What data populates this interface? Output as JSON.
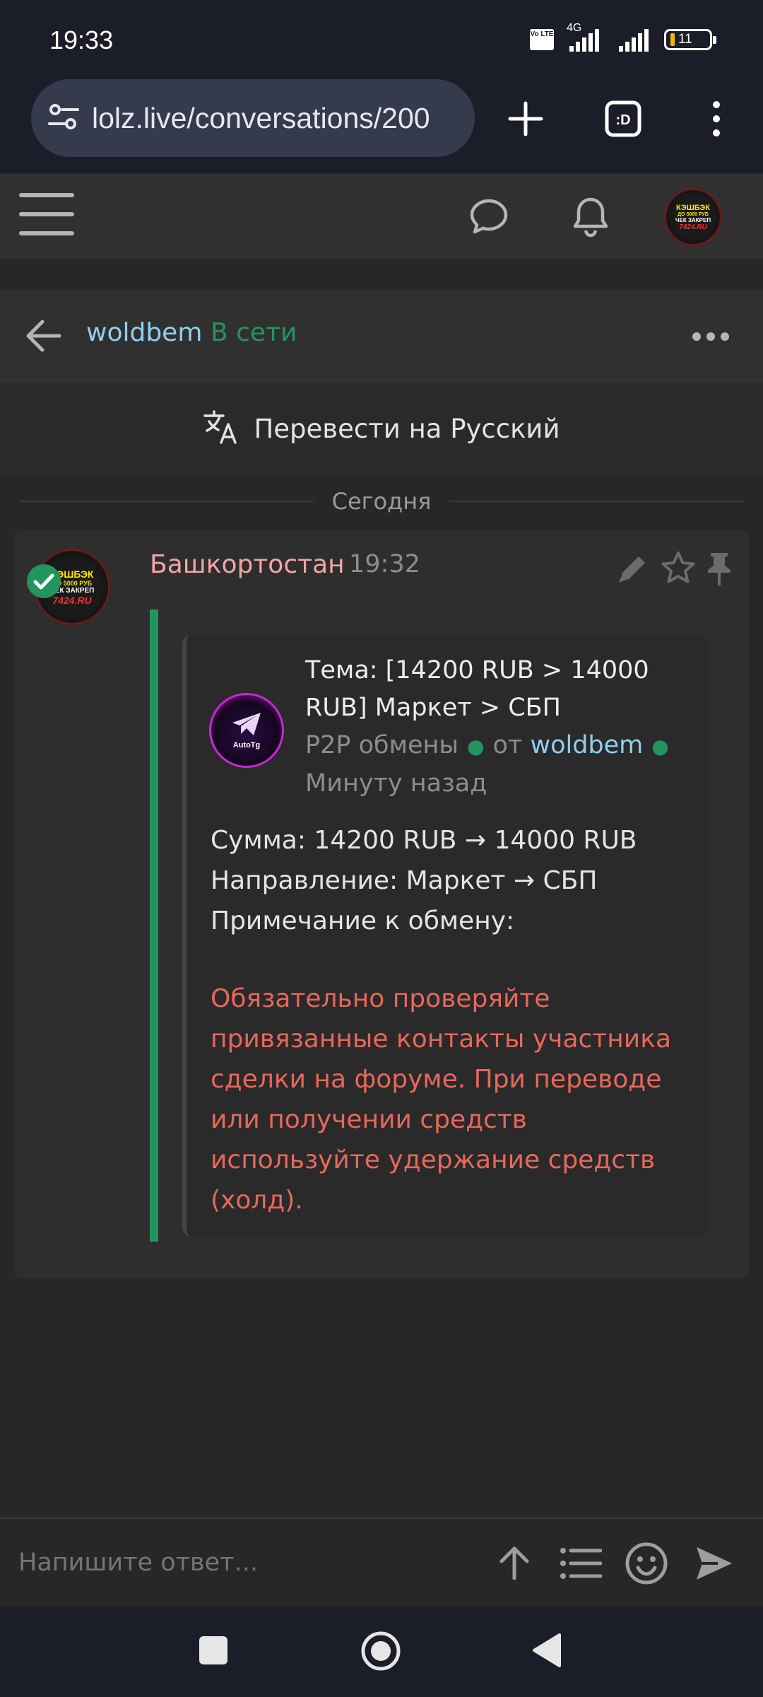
{
  "status_bar": {
    "time": "19:33",
    "volte": "Vo LTE",
    "network": "4G",
    "battery": "11"
  },
  "browser": {
    "url": "lolz.live/conversations/200"
  },
  "header": {
    "avatar_lines": [
      "КЭШБЭК",
      "ДО 5000 РУБ",
      "ЧЕК ЗАКРЕП",
      "7424.RU"
    ]
  },
  "conversation": {
    "username": "woldbem",
    "status": "В сети"
  },
  "translate": {
    "label": "Перевести на Русский"
  },
  "date_separator": "Сегодня",
  "message": {
    "sender": "Башкортостан",
    "time": "19:32",
    "avatar_lines": [
      "КЭШБЭК",
      "ДО 5000 РУБ",
      "ЧЕК ЗАКРЕП",
      "7424.RU"
    ],
    "embed": {
      "avatar_label": "AutoTg",
      "title": "Тема: [14200 RUB > 14000 RUB] Маркет > СБП",
      "section": "P2P обмены",
      "from_label": "от",
      "author": "woldbem",
      "posted": "Минуту назад",
      "body_lines": [
        "Сумма: 14200 RUB → 14000 RUB",
        "Направление: Маркет → СБП",
        "Примечание к обмену:"
      ],
      "warning": "Обязательно проверяйте привязанные контакты участника сделки на форуме. При переводе или получении средств используйте удержание средств (холд)."
    }
  },
  "reply": {
    "placeholder": "Напишите ответ..."
  },
  "colors": {
    "accent_green": "#22955f",
    "username_blue": "#8fd0ee",
    "sender_pink": "#f3a4a4",
    "warning_red": "#e8675a"
  }
}
